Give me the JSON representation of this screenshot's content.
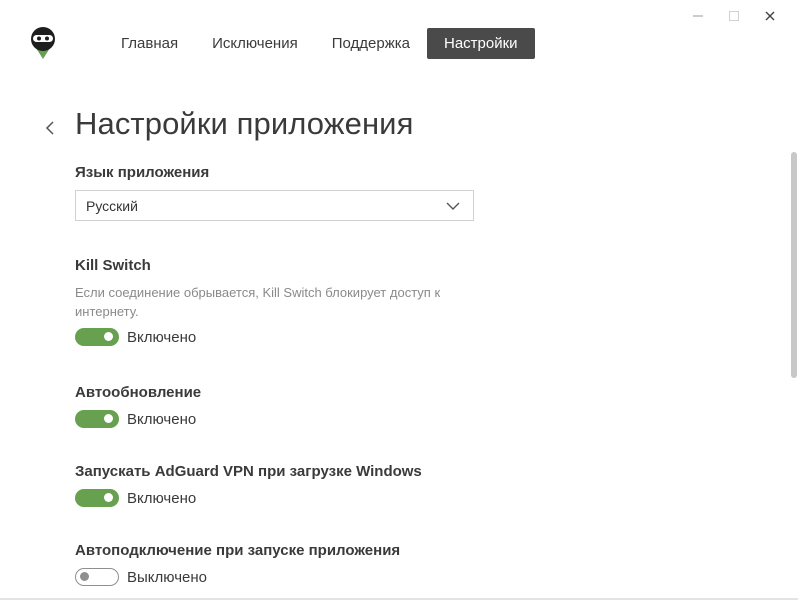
{
  "window": {
    "controls": {
      "minimize": "—",
      "maximize": "☐",
      "close": "✕"
    }
  },
  "brand": {
    "logo_icon": "adguard-ninja-logo",
    "accent": "#67a04f"
  },
  "nav": {
    "items": [
      {
        "label": "Главная",
        "active": false
      },
      {
        "label": "Исключения",
        "active": false
      },
      {
        "label": "Поддержка",
        "active": false
      },
      {
        "label": "Настройки",
        "active": true
      }
    ]
  },
  "page": {
    "title": "Настройки приложения"
  },
  "settings": {
    "language": {
      "label": "Язык приложения",
      "selected": "Русский"
    },
    "kill_switch": {
      "label": "Kill Switch",
      "description": "Если соединение обрывается, Kill Switch блокирует доступ к интернету.",
      "enabled": true,
      "state_label": "Включено"
    },
    "auto_update": {
      "label": "Автообновление",
      "enabled": true,
      "state_label": "Включено"
    },
    "launch_on_startup": {
      "label": "Запускать AdGuard VPN при загрузке Windows",
      "enabled": true,
      "state_label": "Включено"
    },
    "auto_connect": {
      "label": "Автоподключение при запуске приложения",
      "enabled": false,
      "state_label": "Выключено"
    }
  }
}
